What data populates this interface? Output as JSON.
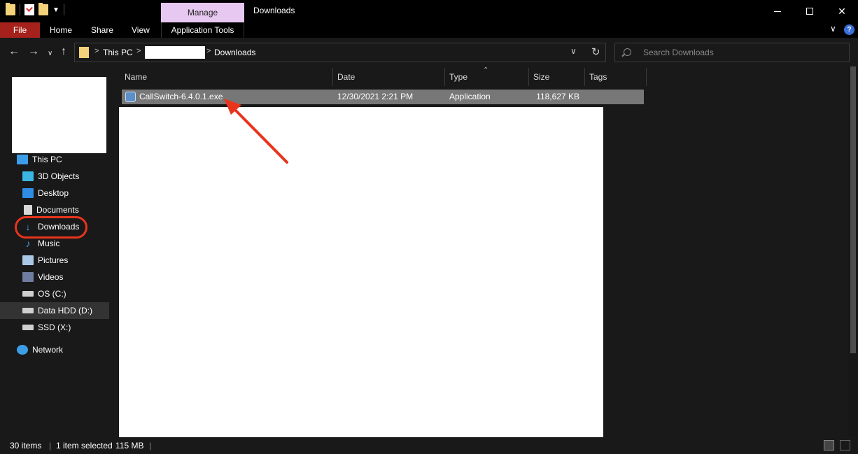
{
  "window": {
    "title": "Downloads",
    "context_tab": "Manage",
    "controls": [
      "minimize",
      "maximize",
      "close"
    ]
  },
  "ribbon": {
    "tabs": [
      "File",
      "Home",
      "Share",
      "View"
    ],
    "context_tab_label": "Application Tools",
    "help": "?"
  },
  "address_bar": {
    "path": [
      "This PC",
      "Downloads"
    ],
    "separator": ">"
  },
  "search": {
    "placeholder": "Search Downloads"
  },
  "nav_pane": {
    "items": [
      {
        "label": "This PC",
        "icon": "computer-icon"
      },
      {
        "label": "3D Objects",
        "icon": "cube-icon"
      },
      {
        "label": "Desktop",
        "icon": "desktop-icon"
      },
      {
        "label": "Documents",
        "icon": "document-icon"
      },
      {
        "label": "Downloads",
        "icon": "download-arrow-icon"
      },
      {
        "label": "Music",
        "icon": "music-note-icon"
      },
      {
        "label": "Pictures",
        "icon": "picture-icon"
      },
      {
        "label": "Videos",
        "icon": "video-icon"
      },
      {
        "label": "OS (C:)",
        "icon": "drive-icon"
      },
      {
        "label": "Data HDD (D:)",
        "icon": "drive-icon"
      },
      {
        "label": "SSD (X:)",
        "icon": "drive-icon"
      },
      {
        "label": "Network",
        "icon": "network-icon"
      }
    ],
    "selected": "Data HDD (D:)",
    "highlighted": "Downloads",
    "highlight_color": "#e8341c"
  },
  "file_list": {
    "columns": [
      "Name",
      "Date",
      "Type",
      "Size",
      "Tags"
    ],
    "rows": [
      {
        "name": "CallSwitch-6.4.0.1.exe",
        "date": "12/30/2021 2:21 PM",
        "type": "Application",
        "size": "118,627 KB"
      }
    ]
  },
  "status_bar": {
    "item_count": "30 items",
    "selection": "1 item selected",
    "selection_size": "115 MB"
  },
  "colors": {
    "file_tab": "#a5221c",
    "manage_tab": "#e6c8f0",
    "annotation": "#e8341c",
    "selected_row": "#777777"
  }
}
